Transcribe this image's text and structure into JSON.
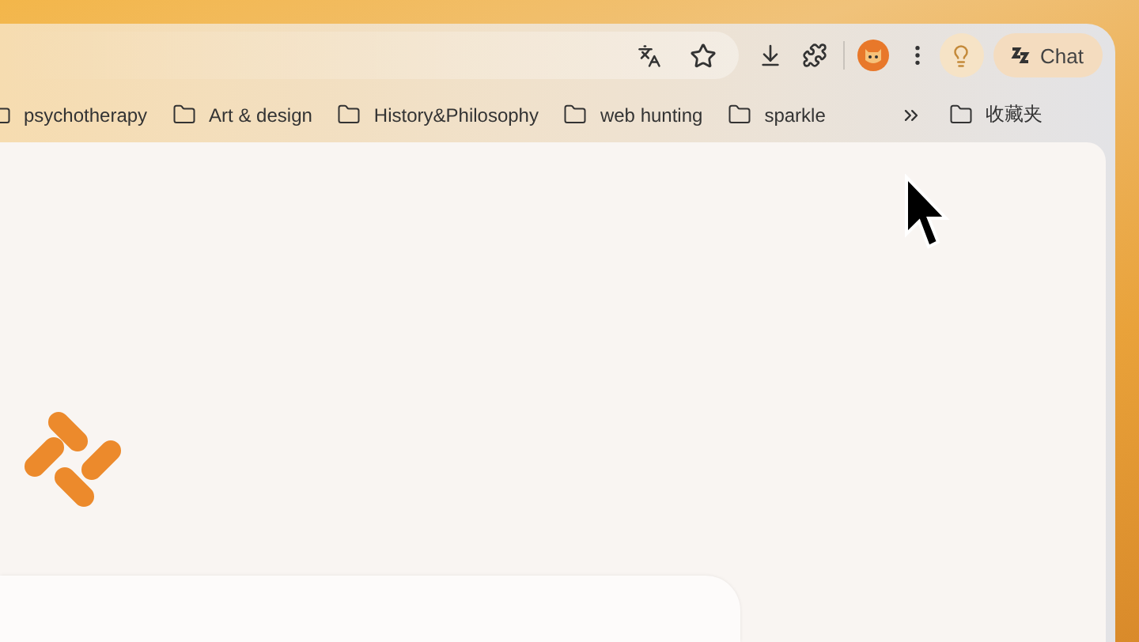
{
  "toolbar": {
    "chat_button": "Chat"
  },
  "bookmarks": [
    {
      "label": "psychotherapy"
    },
    {
      "label": "Art & design"
    },
    {
      "label": "History&Philosophy"
    },
    {
      "label": "web hunting"
    },
    {
      "label": "sparkle"
    }
  ],
  "other_bookmarks": {
    "label": "收藏夹"
  }
}
